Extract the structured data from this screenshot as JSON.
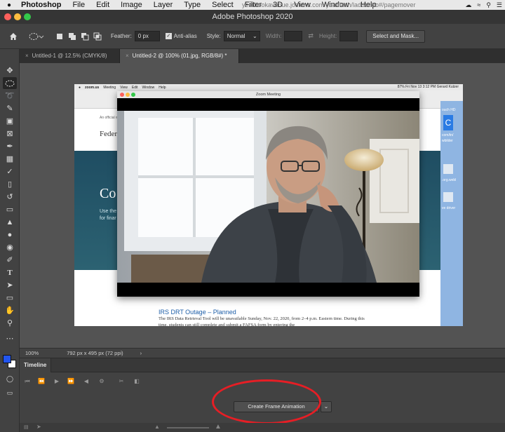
{
  "menubar": {
    "app": "Photoshop",
    "items": [
      "File",
      "Edit",
      "Image",
      "Layer",
      "Type",
      "Select",
      "Filter",
      "3D",
      "View",
      "Window",
      "Help"
    ],
    "url_fragment": "yearbookavenue.jostens.com/ybafflash/ladder.do#/pagemover"
  },
  "window": {
    "title": "Adobe Photoshop 2020"
  },
  "options": {
    "feather_label": "Feather:",
    "feather_value": "0 px",
    "antialias_label": "Anti-alias",
    "style_label": "Style:",
    "style_value": "Normal",
    "width_label": "Width:",
    "height_label": "Height:",
    "select_mask_label": "Select and Mask..."
  },
  "tabs": [
    {
      "label": "Untitled-1 @ 12.5% (CMYK/8)"
    },
    {
      "label": "Untitled-2 @ 100% (01.jpg, RGB/8#) *"
    }
  ],
  "document": {
    "inner_menubar": {
      "app": "zoom.us",
      "items": [
        "Meeting",
        "View",
        "Edit",
        "Window",
        "Help"
      ],
      "right": "87%  Fri Nov 13  3:12 PM  Gerard Kutzer"
    },
    "zoom_title": "Zoom Meeting",
    "browser": {
      "flag_text": "An official website of the United States government",
      "fed_text": "Federal",
      "hero_title": "Co",
      "hero_lines": [
        "Use the",
        "for finar"
      ],
      "news_title": "IRS DRT Outage – Planned",
      "news_body": "The IRS Data Retrieval Tool will be unavailable Sunday, Nov. 22, 2020, from 2–4 p.m. Eastern time. During this time, students can still complete and submit a FAFSA form by entering the"
    },
    "desktop_labels": [
      "ouch HD",
      "com/tn/",
      "wbilder",
      ".org.webl",
      "ve driver"
    ]
  },
  "statusbar": {
    "zoom": "100%",
    "dims": "792 px x 495 px (72 ppi)"
  },
  "timeline": {
    "tab_label": "Timeline",
    "create_label": "Create Frame Animation"
  },
  "colors": {
    "highlight": "#e61e25",
    "foreground": "#2255ee",
    "background": "#ffffff"
  }
}
